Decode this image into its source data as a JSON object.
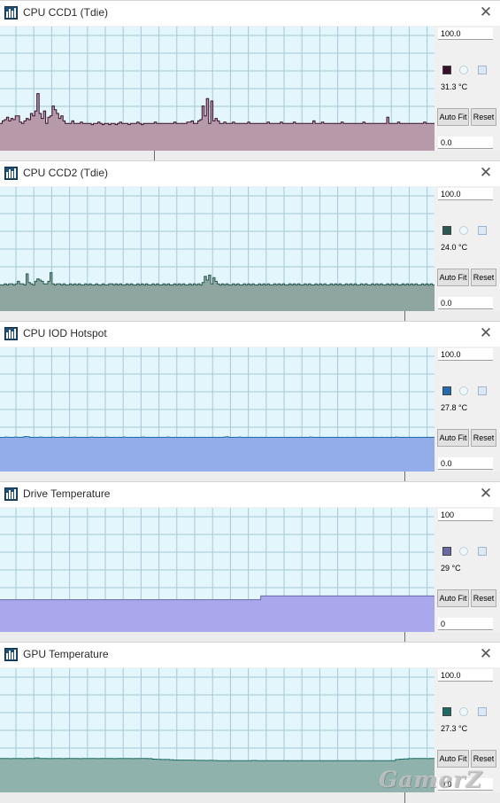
{
  "windows": [
    {
      "title": "CPU CCD1 (Tdie)",
      "max": "100.0",
      "min": "0.0",
      "current": "31.3 °C",
      "auto_fit": "Auto Fit",
      "reset": "Reset",
      "line_color": "#3a0f2c",
      "fill_color": "#b69aaa",
      "series": [
        22,
        24,
        25,
        27,
        24,
        26,
        25,
        28,
        28,
        23,
        22,
        24,
        26,
        25,
        30,
        28,
        32,
        46,
        30,
        26,
        32,
        22,
        27,
        28,
        36,
        33,
        30,
        26,
        28,
        24,
        22,
        22,
        22,
        24,
        22,
        22,
        22,
        23,
        22,
        22,
        22,
        22,
        21,
        22,
        22,
        23,
        22,
        21,
        22,
        22,
        21,
        22,
        22,
        21,
        22,
        23,
        22,
        22,
        22,
        21,
        22,
        22,
        22,
        23,
        22,
        21,
        22,
        22,
        22,
        22,
        22,
        23,
        22,
        22,
        22,
        22,
        22,
        22,
        22,
        22,
        23,
        22,
        22,
        22,
        22,
        22,
        23,
        23,
        24,
        22,
        22,
        24,
        25,
        36,
        28,
        42,
        22,
        40,
        24,
        26,
        24,
        22,
        22,
        23,
        22,
        22,
        22,
        23,
        22,
        22,
        22,
        22,
        22,
        22,
        23,
        22,
        22,
        22,
        22,
        22,
        22,
        22,
        22,
        23,
        22,
        22,
        22,
        22,
        22,
        23,
        22,
        22,
        22,
        22,
        22,
        23,
        22,
        22,
        22,
        22,
        22,
        22,
        22,
        22,
        24,
        22,
        22,
        22,
        23,
        22,
        22,
        22,
        22,
        22,
        22,
        22,
        22,
        23,
        22,
        22,
        22,
        22,
        22,
        22,
        22,
        22,
        22,
        23,
        22,
        22,
        22,
        22,
        22,
        22,
        22,
        22,
        22,
        22,
        27,
        22,
        22,
        22,
        22,
        23,
        22,
        22,
        22,
        22,
        22,
        22,
        22,
        22,
        22,
        22,
        22,
        23,
        22,
        22,
        22,
        22,
        22
      ]
    },
    {
      "title": "CPU CCD2 (Tdie)",
      "max": "100.0",
      "min": "0.0",
      "current": "24.0 °C",
      "auto_fit": "Auto Fit",
      "reset": "Reset",
      "line_color": "#2b5a52",
      "fill_color": "#8fa6a0",
      "series": [
        21,
        21,
        22,
        21,
        22,
        22,
        21,
        22,
        24,
        22,
        22,
        21,
        30,
        23,
        22,
        21,
        24,
        26,
        25,
        24,
        22,
        22,
        24,
        31,
        22,
        21,
        22,
        22,
        21,
        22,
        21,
        21,
        22,
        21,
        22,
        21,
        22,
        21,
        21,
        22,
        21,
        22,
        21,
        21,
        22,
        21,
        21,
        22,
        21,
        21,
        22,
        22,
        21,
        22,
        21,
        22,
        21,
        21,
        22,
        21,
        22,
        21,
        21,
        22,
        21,
        22,
        21,
        22,
        21,
        21,
        22,
        21,
        22,
        21,
        21,
        22,
        21,
        22,
        21,
        21,
        22,
        21,
        22,
        21,
        22,
        21,
        21,
        22,
        21,
        22,
        21,
        22,
        21,
        23,
        28,
        25,
        29,
        22,
        27,
        24,
        22,
        21,
        22,
        21,
        22,
        21,
        21,
        22,
        21,
        22,
        21,
        21,
        22,
        21,
        22,
        21,
        22,
        21,
        21,
        22,
        21,
        22,
        21,
        22,
        21,
        21,
        22,
        21,
        22,
        21,
        22,
        21,
        21,
        22,
        21,
        22,
        21,
        22,
        21,
        21,
        22,
        21,
        22,
        21,
        21,
        22,
        21,
        22,
        21,
        22,
        21,
        21,
        22,
        21,
        22,
        21,
        22,
        21,
        21,
        22,
        21,
        22,
        21,
        22,
        21,
        21,
        22,
        21,
        22,
        21,
        21,
        22,
        21,
        22,
        21,
        22,
        21,
        21,
        22,
        21,
        22,
        21,
        22,
        21,
        21,
        22,
        21,
        22,
        21,
        22,
        21,
        22,
        21,
        21,
        22,
        21,
        22,
        21,
        22,
        21,
        21
      ]
    },
    {
      "title": "CPU IOD Hotspot",
      "max": "100.0",
      "min": "0.0",
      "current": "27.8 °C",
      "auto_fit": "Auto Fit",
      "reset": "Reset",
      "line_color": "#1f6cb0",
      "fill_color": "#93acea",
      "series": [
        27.5,
        27.5,
        27.8,
        27.6,
        27.5,
        27.6,
        27.8,
        27.6,
        27.5,
        27.8,
        28.2,
        28.0,
        27.6,
        27.5,
        27.6,
        27.5,
        27.8,
        27.6,
        27.5,
        27.6,
        27.5,
        27.8,
        27.6,
        27.5,
        27.6,
        27.8,
        27.5,
        27.6,
        27.5,
        27.6,
        27.8,
        27.5,
        27.6,
        27.5,
        27.6,
        27.5,
        27.6,
        27.8,
        27.5,
        27.6,
        27.5,
        27.6,
        27.5,
        27.8,
        27.6,
        27.5,
        27.6,
        27.5,
        27.6,
        27.5,
        27.8,
        27.6,
        27.5,
        27.6,
        27.5,
        27.6,
        27.5,
        27.6,
        27.8,
        27.5,
        27.6,
        27.5,
        27.6,
        27.5,
        27.6,
        27.5,
        27.6,
        27.5,
        27.8,
        27.6,
        27.5,
        27.6,
        27.5,
        27.6,
        27.5,
        27.6,
        27.5,
        27.6,
        27.5,
        27.6,
        27.5,
        27.6,
        27.5,
        27.6,
        27.5,
        27.6,
        27.5,
        27.6,
        27.5,
        27.6,
        27.5,
        27.8,
        28.0,
        27.6,
        27.5,
        27.6,
        27.5,
        27.8,
        27.6,
        27.5,
        27.6,
        27.5,
        27.6,
        27.5,
        27.6,
        27.5,
        27.6,
        27.5,
        27.6,
        27.5,
        27.6,
        27.5,
        27.6,
        27.5,
        27.6,
        27.5,
        27.6,
        27.5,
        27.6,
        27.5,
        27.6,
        27.5,
        27.6,
        27.5,
        27.6,
        27.5,
        27.8,
        27.6,
        27.5,
        27.6,
        27.5,
        27.6,
        27.5,
        27.6,
        27.5,
        27.6,
        27.5,
        27.6,
        27.5,
        27.6,
        27.5,
        27.6,
        27.5,
        27.6,
        27.5,
        27.6,
        27.5,
        27.6,
        27.5,
        27.6,
        27.5,
        27.6,
        27.5,
        27.6,
        27.5,
        27.6,
        27.5,
        27.6,
        27.5,
        27.6,
        27.5,
        27.8,
        27.6,
        27.5,
        27.6,
        27.5,
        27.6,
        27.5,
        27.6,
        27.5,
        27.6,
        27.5,
        27.6,
        27.5,
        27.6,
        27.5,
        27.6,
        27.8
      ]
    },
    {
      "title": "Drive Temperature",
      "max": "100",
      "min": "0",
      "current": "29 °C",
      "auto_fit": "Auto Fit",
      "reset": "Reset",
      "line_color": "#6a6aa8",
      "fill_color": "#aaa8ec",
      "series": [
        26,
        26,
        26,
        26,
        26,
        26,
        26,
        26,
        26,
        26,
        26,
        26,
        26,
        26,
        26,
        26,
        26,
        26,
        26,
        26,
        26,
        26,
        26,
        26,
        26,
        26,
        26,
        26,
        26,
        26,
        26,
        26,
        26,
        26,
        26,
        26,
        26,
        26,
        26,
        26,
        26,
        26,
        26,
        26,
        26,
        26,
        26,
        26,
        26,
        26,
        26,
        26,
        26,
        26,
        26,
        26,
        26,
        26,
        26,
        26,
        29,
        29,
        29,
        29,
        29,
        29,
        29,
        29,
        29,
        29,
        29,
        29,
        29,
        29,
        29,
        29,
        29,
        29,
        29,
        29,
        29,
        29,
        29,
        29,
        29,
        29,
        29,
        29,
        29,
        29,
        29,
        29,
        29,
        29,
        29,
        29,
        29,
        29,
        29,
        29,
        29
      ]
    },
    {
      "title": "GPU Temperature",
      "max": "100.0",
      "min": "0.0",
      "current": "27.3 °C",
      "auto_fit": "Auto Fit",
      "reset": "Reset",
      "line_color": "#1e6a64",
      "fill_color": "#8fb2ac",
      "series": [
        27.3,
        27.3,
        27.2,
        27.3,
        27.3,
        27.2,
        27.3,
        27.3,
        27.8,
        27.3,
        27.3,
        27.2,
        27.3,
        27.3,
        27.2,
        27.3,
        27.3,
        27.3,
        27.2,
        27.3,
        27.3,
        27.3,
        27.2,
        27.3,
        27.3,
        27.3,
        27.2,
        27.3,
        27.3,
        27.3,
        27.2,
        27.3,
        27.3,
        27.3,
        27.2,
        26.8,
        26.6,
        26.5,
        26.5,
        26.2,
        26.1,
        26.0,
        26.0,
        26.0,
        25.9,
        25.8,
        25.8,
        25.7,
        25.8,
        25.7,
        25.6,
        25.6,
        25.5,
        25.6,
        25.5,
        25.6,
        25.5,
        25.6,
        25.7,
        25.5,
        25.5,
        25.5,
        25.6,
        25.5,
        25.5,
        25.6,
        25.5,
        25.5,
        25.5,
        25.5,
        25.5,
        25.5,
        25.5,
        25.5,
        25.5,
        25.5,
        25.5,
        25.5,
        25.5,
        25.5,
        25.5,
        25.5,
        25.5,
        25.5,
        25.5,
        25.5,
        25.5,
        25.5,
        25.5,
        25.5,
        25.5,
        26.5,
        26.8,
        27.0,
        27.2,
        27.3,
        27.3,
        27.3,
        27.2,
        27.3,
        27.3
      ]
    }
  ],
  "watermark": "GamerZ"
}
